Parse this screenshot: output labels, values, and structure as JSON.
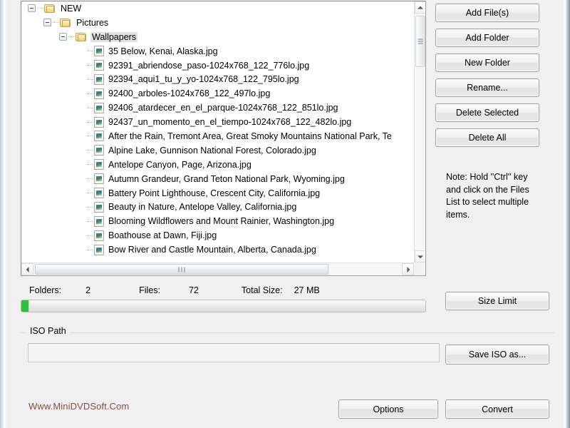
{
  "tree": {
    "folders": [
      {
        "label": "NEW",
        "depth": 0
      },
      {
        "label": "Pictures",
        "depth": 1
      },
      {
        "label": "Wallpapers",
        "depth": 2,
        "selected": true
      }
    ],
    "files": [
      "35 Below, Kenai, Alaska.jpg",
      "92391_abriendose_paso-1024x768_122_776lo.jpg",
      "92394_aqui1_tu_y_yo-1024x768_122_795lo.jpg",
      "92400_arboles-1024x768_122_497lo.jpg",
      "92406_atardecer_en_el_parque-1024x768_122_851lo.jpg",
      "92437_un_momento_en_el_tiempo-1024x768_122_482lo.jpg",
      "After the Rain, Tremont Area, Great Smoky Mountains National Park, Te",
      "Alpine Lake, Gunnison National Forest, Colorado.jpg",
      "Antelope Canyon, Page, Arizona.jpg",
      "Autumn Grandeur, Grand Teton National Park, Wyoming.jpg",
      "Battery Point Lighthouse, Crescent City, California.jpg",
      "Beauty in Nature, Antelope Valley, California.jpg",
      "Blooming Wildflowers and Mount Rainier, Washington.jpg",
      "Boathouse at Dawn, Fiji.jpg",
      "Bow River and Castle Mountain, Alberta, Canada.jpg"
    ]
  },
  "side_buttons": [
    {
      "label": "Add File(s)",
      "name": "add-files-button"
    },
    {
      "label": "Add Folder",
      "name": "add-folder-button"
    },
    {
      "label": "New Folder",
      "name": "new-folder-button"
    },
    {
      "label": "Rename...",
      "name": "rename-button"
    },
    {
      "label": "Delete Selected",
      "name": "delete-selected-button"
    },
    {
      "label": "Delete All",
      "name": "delete-all-button"
    }
  ],
  "note": "Note: Hold ''Ctrl'' key and click on the Files List to select multiple items.",
  "status": {
    "folders_label": "Folders:",
    "folders_value": "2",
    "files_label": "Files:",
    "files_value": "72",
    "size_label": "Total Size:",
    "size_value": "27 MB",
    "progress_percent": 2,
    "progress_color": "#2fbf3f"
  },
  "size_limit_button": "Size Limit",
  "iso": {
    "legend": "ISO Path",
    "value": "",
    "placeholder": "",
    "save_button": "Save ISO as..."
  },
  "footer": {
    "brand": "Www.MiniDVDSoft.Com",
    "brand_color": "#8c4a44",
    "options_button": "Options",
    "convert_button": "Convert"
  }
}
